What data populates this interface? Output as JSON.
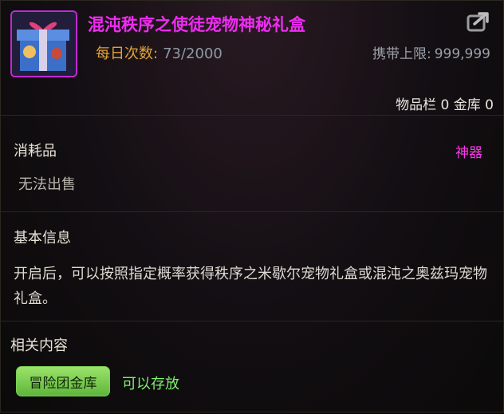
{
  "item": {
    "name": "混沌秩序之使徒宠物神秘礼盒",
    "icon": "gift-box-icon",
    "daily_label": "每日次数:",
    "daily_value": "73/2000",
    "carry_label": "携带上限:",
    "carry_value": "999,999",
    "storage_text": "物品栏 0 金库 0"
  },
  "category": {
    "title": "消耗品",
    "grade": "神器",
    "sell_note": "无法出售"
  },
  "basic_info": {
    "title": "基本信息",
    "description": "开启后，可以按照指定概率获得秩序之米歇尔宠物礼盒或混沌之奥兹玛宠物礼盒。"
  },
  "related": {
    "title": "相关内容",
    "button_label": "冒险团金库",
    "status": "可以存放"
  },
  "colors": {
    "item_name": "#ee2cf2",
    "grade": "#ff37ea",
    "daily_label": "#e1a33a",
    "button": "#7bd04e",
    "status": "#7ef06d"
  }
}
